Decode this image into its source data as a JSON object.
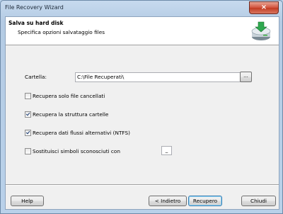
{
  "window": {
    "title": "File Recovery Wizard",
    "close_glyph": "×"
  },
  "header": {
    "title": "Salva su hard disk",
    "subtitle": "Specifica opzioni salvataggio files",
    "icon": "save-to-disk-icon"
  },
  "folder": {
    "label": "Cartella:",
    "value": "C:\\File Recuperati\\",
    "browse_label": "..."
  },
  "options": [
    {
      "label": "Recupera solo file cancellati",
      "checked": false
    },
    {
      "label": "Recupera la struttura cartelle",
      "checked": true
    },
    {
      "label": "Recupera dati flussi alternativi (NTFS)",
      "checked": true
    },
    {
      "label": "Sostituisci simboli sconosciuti con",
      "checked": false
    }
  ],
  "replace_symbol": "_",
  "buttons": {
    "help": "Help",
    "back": "< Indietro",
    "recover": "Recupero",
    "close": "Chiudi"
  }
}
